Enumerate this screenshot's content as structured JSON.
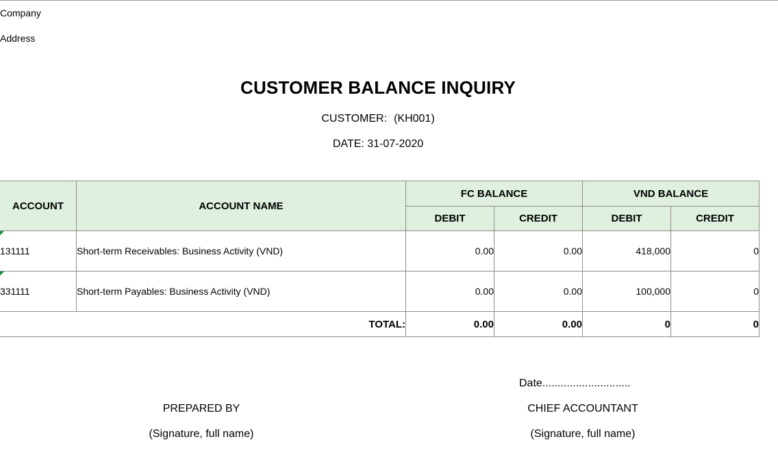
{
  "header": {
    "company": "Company",
    "address": "Address"
  },
  "report": {
    "title": "CUSTOMER BALANCE INQUIRY",
    "customer_label": "CUSTOMER:",
    "customer_value": "(KH001)",
    "date_label": "DATE:",
    "date_value": "31-07-2020"
  },
  "table": {
    "columns": {
      "account": "ACCOUNT",
      "account_name": "ACCOUNT NAME",
      "fc_balance": "FC BALANCE",
      "vnd_balance": "VND BALANCE",
      "debit": "DEBIT",
      "credit": "CREDIT"
    },
    "rows": [
      {
        "account": "131111",
        "name": "Short-term Receivables: Business Activity (VND)",
        "fc_debit": "0.00",
        "fc_credit": "0.00",
        "vnd_debit": "418,000",
        "vnd_credit": "0"
      },
      {
        "account": "331111",
        "name": "Short-term Payables: Business Activity (VND)",
        "fc_debit": "0.00",
        "fc_credit": "0.00",
        "vnd_debit": "100,000",
        "vnd_credit": "0"
      }
    ],
    "total": {
      "label": "TOTAL:",
      "fc_debit": "0.00",
      "fc_credit": "0.00",
      "vnd_debit": "0",
      "vnd_credit": "0"
    }
  },
  "signatures": {
    "date_line": "Date.............................",
    "left_title": "PREPARED BY",
    "left_note": "(Signature, full name)",
    "right_title": "CHIEF ACCOUNTANT",
    "right_note": "(Signature, full name)"
  },
  "colors": {
    "header_fill": "#dff0df",
    "grid_line": "#8c8c8c",
    "cell_flag": "#1e8a3a"
  }
}
